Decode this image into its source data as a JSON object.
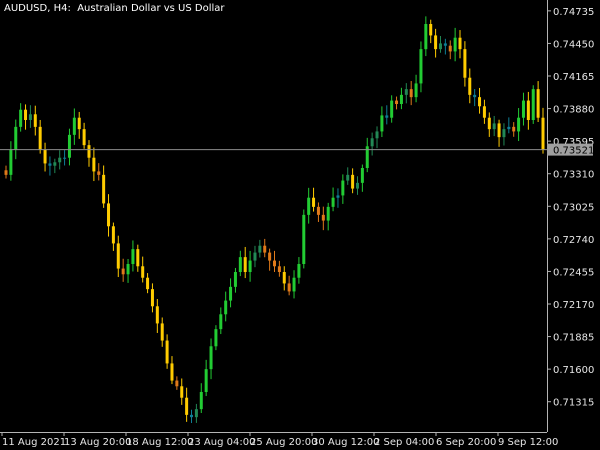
{
  "header": {
    "symbol": "AUDUSD, H4:",
    "description": "Australian Dollar vs US Dollar"
  },
  "chart_data": {
    "type": "candlestick",
    "ylim": [
      0.7105,
      0.7483
    ],
    "y_ticks": [
      "0.74735",
      "0.74450",
      "0.74165",
      "0.73880",
      "0.73595",
      "0.73310",
      "0.73025",
      "0.72740",
      "0.72455",
      "0.72170",
      "0.71885",
      "0.71600",
      "0.71315"
    ],
    "x_ticks": [
      "11 Aug 2021",
      "13 Aug 20:00",
      "18 Aug 12:00",
      "23 Aug 04:00",
      "25 Aug 20:00",
      "30 Aug 12:00",
      "2 Sep 04:00",
      "6 Sep 20:00",
      "9 Sep 12:00"
    ],
    "current_price": "0.73521",
    "colors": {
      "background": "#000000",
      "axis": "#b4b4b4",
      "price_line": "#8c8c8c",
      "up_strong": "#22cc33",
      "up_mild": "#228855",
      "down_strong": "#ffcc00",
      "down_mild": "#e07a1a",
      "neutral": "#0f7f96"
    },
    "closes": [
      0.733,
      0.7352,
      0.7372,
      0.7387,
      0.7378,
      0.7383,
      0.7372,
      0.7352,
      0.734,
      0.7338,
      0.7341,
      0.7345,
      0.7345,
      0.7365,
      0.738,
      0.737,
      0.7356,
      0.7345,
      0.7333,
      0.733,
      0.7305,
      0.7285,
      0.727,
      0.7248,
      0.7243,
      0.7252,
      0.7265,
      0.725,
      0.724,
      0.723,
      0.7215,
      0.72,
      0.7185,
      0.7165,
      0.715,
      0.7145,
      0.7135,
      0.712,
      0.7118,
      0.7125,
      0.714,
      0.716,
      0.718,
      0.7195,
      0.7208,
      0.722,
      0.7232,
      0.7245,
      0.7258,
      0.7245,
      0.7255,
      0.7262,
      0.7268,
      0.7262,
      0.7255,
      0.725,
      0.7245,
      0.7235,
      0.7228,
      0.724,
      0.7252,
      0.7295,
      0.731,
      0.7302,
      0.7295,
      0.729,
      0.7302,
      0.731,
      0.7312,
      0.7325,
      0.733,
      0.7318,
      0.7323,
      0.7336,
      0.7355,
      0.7362,
      0.7368,
      0.7382,
      0.738,
      0.7395,
      0.7392,
      0.74,
      0.7405,
      0.7398,
      0.741,
      0.744,
      0.7462,
      0.7452,
      0.744,
      0.7445,
      0.7443,
      0.7438,
      0.745,
      0.744,
      0.7415,
      0.74,
      0.7398,
      0.739,
      0.738,
      0.737,
      0.7375,
      0.7363,
      0.737,
      0.7372,
      0.7368,
      0.738,
      0.7395,
      0.7378,
      0.7405,
      0.738,
      0.7352
    ]
  }
}
